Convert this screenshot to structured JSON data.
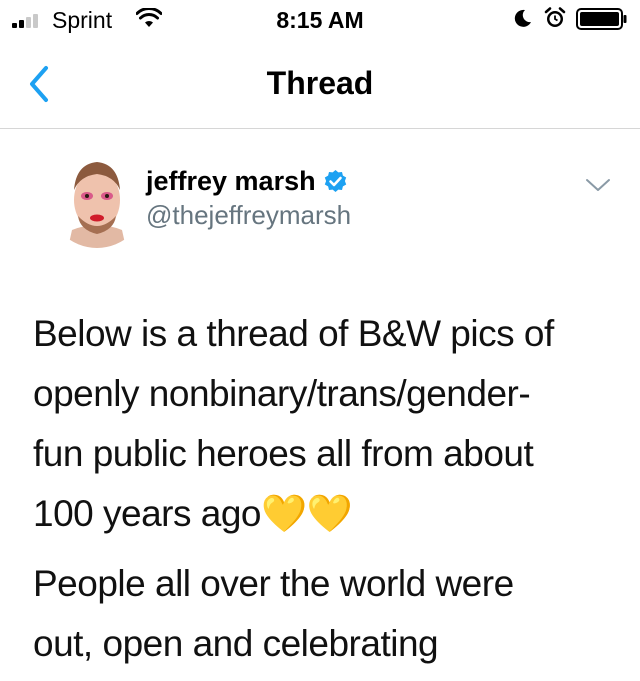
{
  "status_bar": {
    "carrier": "Sprint",
    "time": "8:15 AM",
    "icons": [
      "signal-icon",
      "wifi-icon",
      "moon-icon",
      "alarm-icon",
      "battery-icon"
    ]
  },
  "nav": {
    "title": "Thread",
    "back_icon": "chevron-left-icon",
    "accent": "#1da1f2"
  },
  "tweet": {
    "author_name": "jeffrey marsh",
    "handle": "@thejeffreymarsh",
    "verified": true,
    "paragraphs": [
      "Below is a thread of B&W pics of\nopenly nonbinary/trans/gender-\nfun public heroes all from about\n100 years ago💛💛",
      "People all over the world were\nout, open and celebrating"
    ],
    "menu_icon": "chevron-down-icon"
  },
  "colors": {
    "accent": "#1da1f2",
    "secondary_text": "#66757f",
    "divider": "#d6d6d6"
  }
}
